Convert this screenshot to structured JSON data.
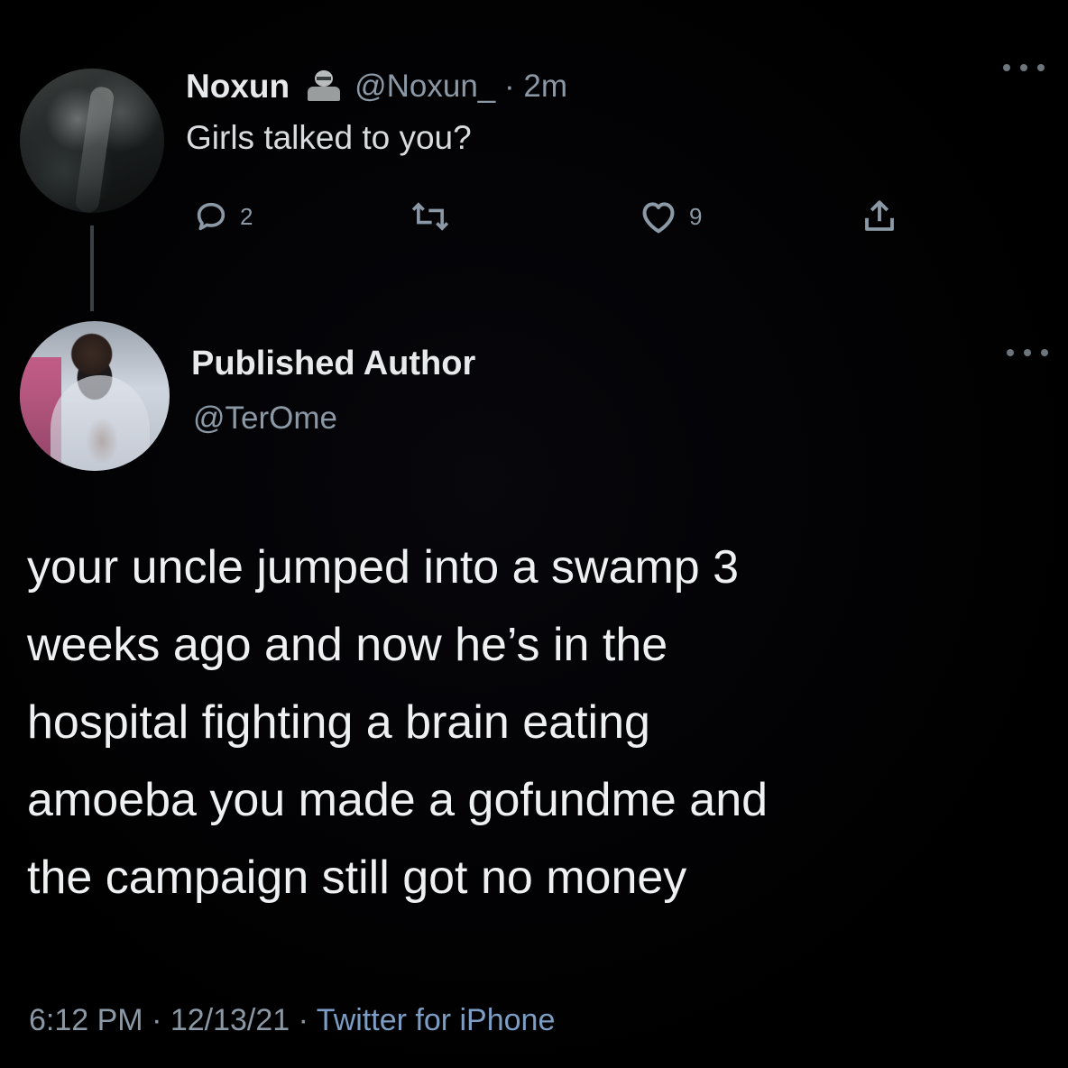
{
  "parent_tweet": {
    "display_name": "Noxun",
    "badge_icon": "bust-statue-icon",
    "handle_time": "@Noxun_ · 2m",
    "text": "Girls talked to you?",
    "actions": {
      "reply_count": "2",
      "retweet_count": "",
      "like_count": "9"
    }
  },
  "reply_tweet": {
    "display_name": "Published Author",
    "handle": "@TerOme",
    "text_lines": [
      "your uncle jumped into a swamp 3",
      "weeks ago and now he’s in the",
      "hospital fighting a brain eating",
      "amoeba you made a gofundme and",
      "the campaign still got no money"
    ],
    "timestamp": "6:12 PM · 12/13/21 · ",
    "source": "Twitter for iPhone"
  },
  "colors": {
    "background": "#000000",
    "primary_text": "#e7e9ea",
    "secondary_text": "#8b98a5",
    "source_link": "#7d9ec4",
    "thread_line": "#3b4045"
  }
}
